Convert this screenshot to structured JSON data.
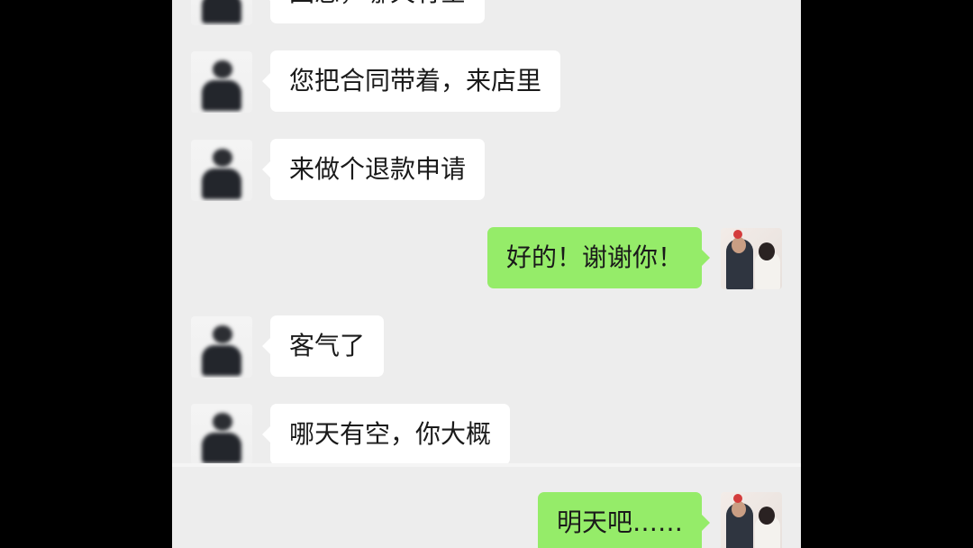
{
  "chat": {
    "messages": [
      {
        "sender": "them",
        "text": "回您，哪天有空"
      },
      {
        "sender": "them",
        "text": "您把合同带着，来店里"
      },
      {
        "sender": "them",
        "text": "来做个退款申请"
      },
      {
        "sender": "me",
        "text": "好的！谢谢你！"
      },
      {
        "sender": "them",
        "text": "客气了"
      },
      {
        "sender": "them",
        "text": "哪天有空，你大概"
      },
      {
        "sender": "me",
        "text": "明天吧……"
      }
    ]
  },
  "colors": {
    "chat_background": "#ededed",
    "incoming_bubble": "#ffffff",
    "outgoing_bubble": "#95ec69",
    "frame": "#000000"
  },
  "icons": {
    "them_avatar": "person-avatar-blurred",
    "me_avatar": "couple-photo-avatar"
  }
}
